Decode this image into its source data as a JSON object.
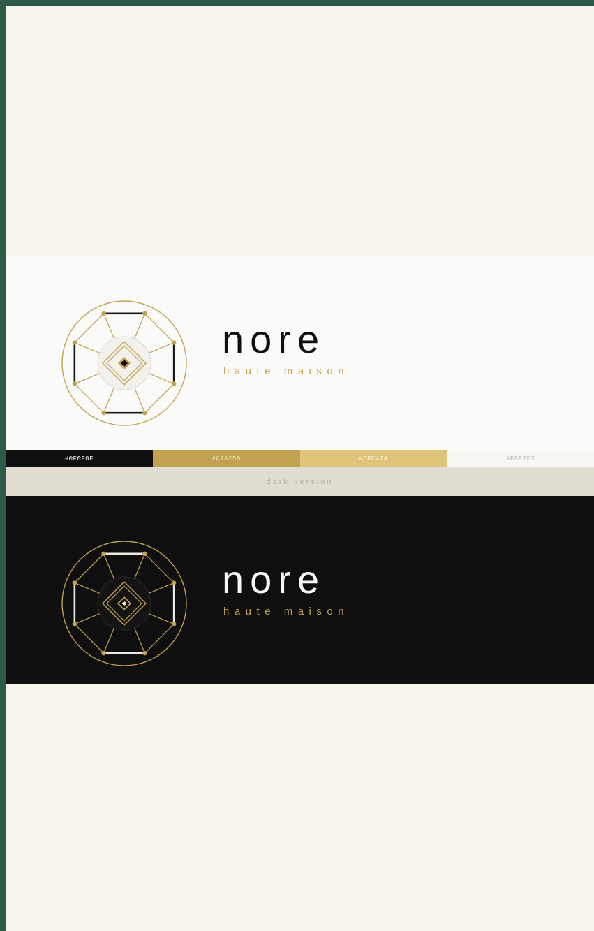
{
  "colors": {
    "frame": "#2f5a45",
    "page_background": "#f7f3ed",
    "light_band": "#fafaf8",
    "dark_band": "#0f0f0f",
    "separator": "#e2ddd3",
    "accent": "#c2a250"
  },
  "light_logo": {
    "wordmark": "nore",
    "tagline": "haute maison",
    "icon": "octagon-diamond-emblem-icon"
  },
  "palette": {
    "swatches": [
      {
        "label": "#0F0F0F",
        "color": "#0f0f0f",
        "text_color": "#f8f7f3"
      },
      {
        "label": "#C2A250",
        "color": "#c2a250",
        "text_color": "#f2e6c4"
      },
      {
        "label": "#DFC47A",
        "color": "#dfc47a",
        "text_color": "#fbf3da"
      },
      {
        "label": "#F8F7F3",
        "color": "#f8f7f3",
        "text_color": "#b9b6ae"
      }
    ]
  },
  "separator": {
    "label": "dark version"
  },
  "dark_logo": {
    "wordmark": "nore",
    "tagline": "haute maison",
    "icon": "octagon-diamond-emblem-icon"
  }
}
